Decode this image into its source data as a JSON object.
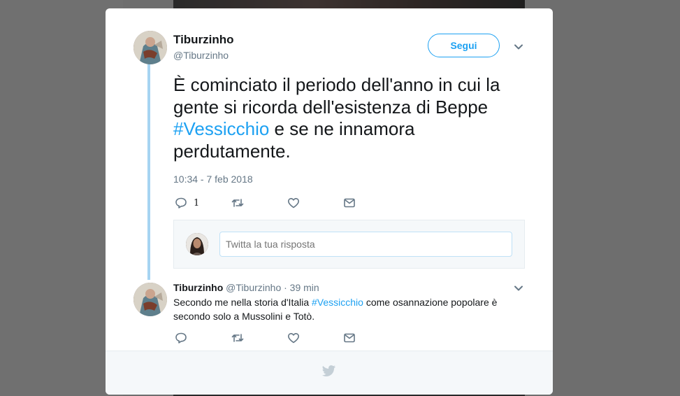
{
  "tweet": {
    "author_name": "Tiburzinho",
    "author_handle": "@Tiburzinho",
    "follow_label": "Segui",
    "text_before": "È cominciato il periodo dell'anno in cui la gente si ricorda dell'esistenza di Beppe ",
    "hashtag": "#Vessicchio",
    "text_after": " e se ne innamora perdutamente.",
    "timestamp": "10:34 - 7 feb 2018",
    "reply_count": "1"
  },
  "reply_compose": {
    "placeholder": "Twitta la tua risposta"
  },
  "reply": {
    "author_name": "Tiburzinho",
    "meta": " @Tiburzinho · 39 min",
    "text_before": "Secondo me nella storia d'Italia ",
    "hashtag": "#Vessicchio",
    "text_after": " come osannazione popolare è secondo solo a Mussolini e Totò."
  },
  "colors": {
    "accent": "#1da1f2",
    "thread_line": "#a6d4f2",
    "secondary_text": "#657786"
  },
  "icons": [
    "chevron-down-icon",
    "reply-icon",
    "retweet-icon",
    "like-icon",
    "direct-message-icon",
    "twitter-bird-icon"
  ]
}
